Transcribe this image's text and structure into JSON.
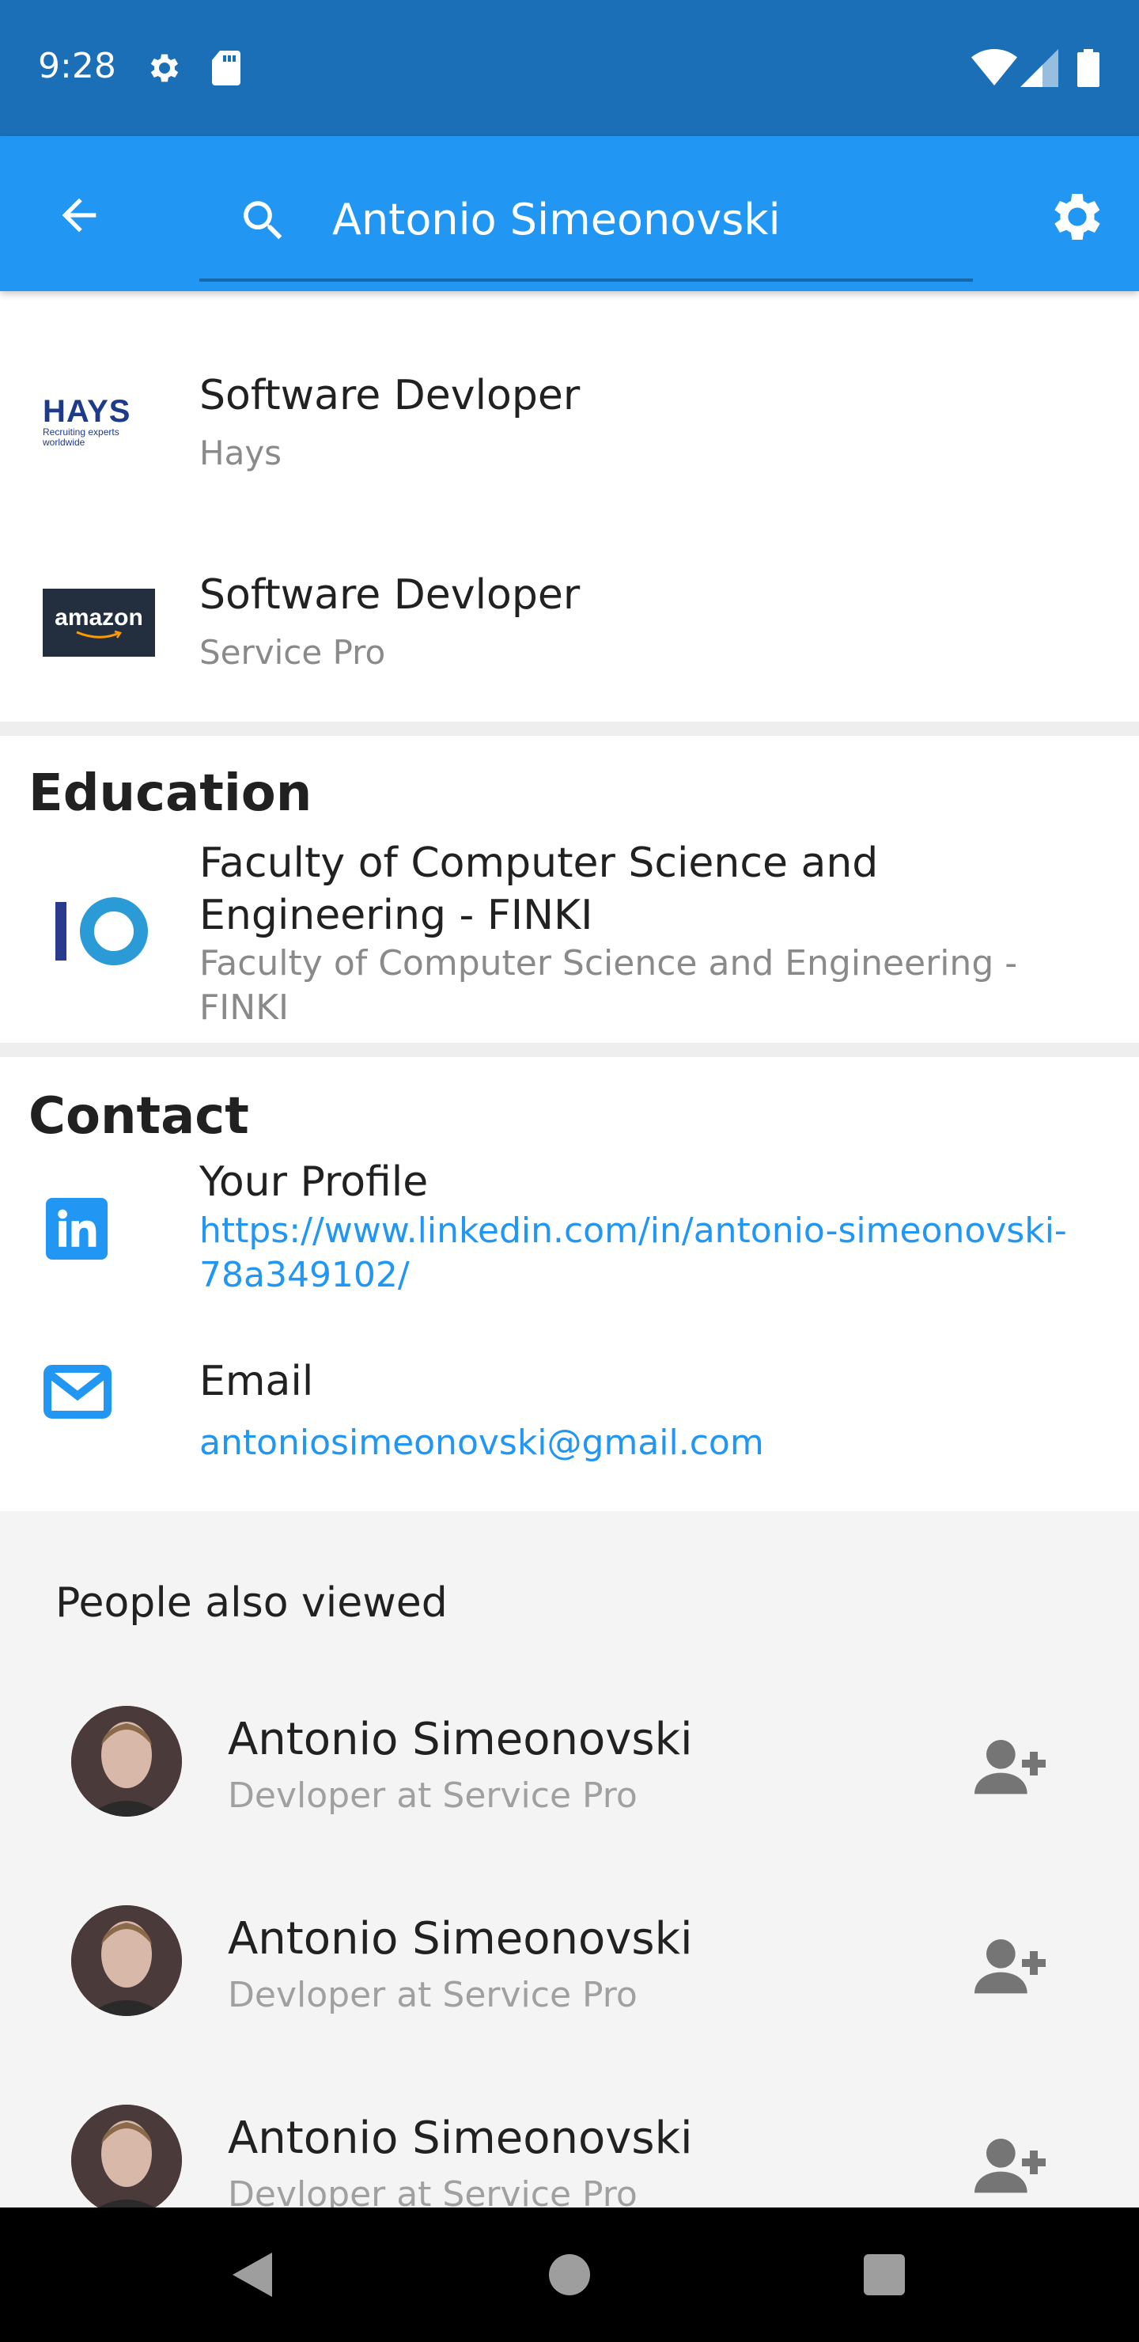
{
  "status_bar": {
    "time": "9:28",
    "icons": [
      "gear-icon",
      "sd-card-icon",
      "wifi-icon",
      "signal-icon",
      "battery-icon"
    ]
  },
  "app_bar": {
    "back_icon": "arrow-left-icon",
    "search_value": "Antonio Simeonovski",
    "settings_icon": "gear-icon",
    "color": "#2196f3"
  },
  "experience": [
    {
      "logo": "hays-logo",
      "logo_text": "HAYS",
      "logo_tagline": "Recruiting experts worldwide",
      "title": "Software Devloper",
      "company": "Hays"
    },
    {
      "logo": "amazon-logo",
      "logo_text": "amazon",
      "title": "Software Devloper",
      "company": "Service Pro"
    }
  ],
  "education": {
    "title": "Education",
    "item": {
      "logo": "finki-logo",
      "name": "Faculty of Computer Science and Engineering - FINKI",
      "sub": "Faculty of Computer Science and Engineering - FINKI"
    }
  },
  "contact": {
    "title": "Contact",
    "items": [
      {
        "icon": "linkedin-icon",
        "label": "Your Profile",
        "value": "https://www.linkedin.com/in/antonio-simeonovski-78a349102/"
      },
      {
        "icon": "envelope-icon",
        "label": "Email",
        "value": "antoniosimeonovski@gmail.com"
      }
    ]
  },
  "people_also_viewed": {
    "title": "People also viewed",
    "people": [
      {
        "name": "Antonio Simeonovski",
        "sub": "Devloper  at Service Pro",
        "action_icon": "add-person-icon"
      },
      {
        "name": "Antonio Simeonovski",
        "sub": "Devloper  at Service Pro",
        "action_icon": "add-person-icon"
      },
      {
        "name": "Antonio Simeonovski",
        "sub": "Devloper  at Service Pro",
        "action_icon": "add-person-icon"
      }
    ]
  },
  "nav_bar": {
    "icons": [
      "back-triangle-icon",
      "home-circle-icon",
      "recents-square-icon"
    ]
  },
  "colors": {
    "accent": "#2196f3",
    "status_bar": "#1a6fb7",
    "link": "#2196f3"
  }
}
